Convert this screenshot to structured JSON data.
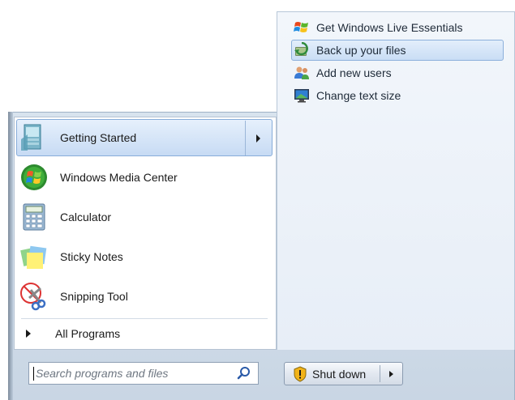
{
  "right_pane": {
    "items": [
      {
        "label": "Get Windows Live Essentials",
        "icon": "windows-flag-icon",
        "selected": false
      },
      {
        "label": "Back up your files",
        "icon": "backup-icon",
        "selected": true
      },
      {
        "label": "Add new users",
        "icon": "users-icon",
        "selected": false
      },
      {
        "label": "Change text size",
        "icon": "display-icon",
        "selected": false
      }
    ]
  },
  "programs": [
    {
      "label": "Getting Started",
      "icon": "getting-started-icon",
      "selected": true,
      "has_submenu": true
    },
    {
      "label": "Windows Media Center",
      "icon": "media-center-icon",
      "selected": false
    },
    {
      "label": "Calculator",
      "icon": "calculator-icon",
      "selected": false
    },
    {
      "label": "Sticky Notes",
      "icon": "sticky-notes-icon",
      "selected": false
    },
    {
      "label": "Snipping Tool",
      "icon": "scissors-icon",
      "selected": false
    }
  ],
  "all_programs": {
    "label": "All Programs"
  },
  "search": {
    "placeholder": "Search programs and files"
  },
  "shutdown": {
    "label": "Shut down"
  },
  "colors": {
    "selection": "#c9ddf5",
    "selection_border": "#8cb0db",
    "frame": "#c9d6e4"
  }
}
